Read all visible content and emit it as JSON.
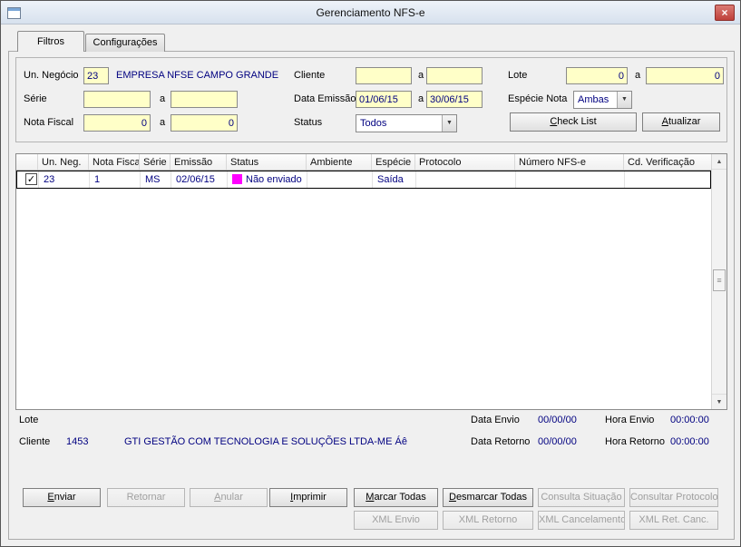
{
  "window": {
    "title": "Gerenciamento NFS-e"
  },
  "icons": {
    "close": "×",
    "dropdown_arrow": "▼",
    "checkmark": "✓",
    "scroll_up": "▲",
    "scroll_down": "▼",
    "grip": "≡"
  },
  "tabs": [
    {
      "label": "Filtros",
      "active": true
    },
    {
      "label": "Configurações",
      "active": false
    }
  ],
  "filters": {
    "sep": "a",
    "un_negocio": {
      "label": "Un. Negócio",
      "value": "23",
      "description": "EMPRESA NFSE CAMPO GRANDE"
    },
    "cliente": {
      "label": "Cliente",
      "from": "",
      "to": ""
    },
    "lote": {
      "label": "Lote",
      "from": "0",
      "to": "0"
    },
    "serie": {
      "label": "Série",
      "from": "",
      "to": ""
    },
    "data_emissao": {
      "label": "Data Emissão",
      "from": "01/06/15",
      "to": "30/06/15"
    },
    "especie_nota": {
      "label": "Espécie Nota",
      "value": "Ambas"
    },
    "nota_fiscal": {
      "label": "Nota Fiscal",
      "from": "0",
      "to": "0"
    },
    "status": {
      "label": "Status",
      "value": "Todos"
    },
    "check_list_button": "Check List",
    "atualizar_button": "Atualizar"
  },
  "grid": {
    "columns": [
      "",
      "Un. Neg.",
      "Nota Fiscal",
      "Série",
      "Emissão",
      "Status",
      "Ambiente",
      "Espécie",
      "Protocolo",
      "Número NFS-e",
      "Cd. Verificação"
    ],
    "rows": [
      {
        "checked": true,
        "un_neg": "23",
        "nota_fiscal": "1",
        "serie": "MS",
        "emissao": "02/06/15",
        "status": "Não enviado",
        "status_color": "#FF00FF",
        "ambiente": "",
        "especie": "Saída",
        "protocolo": "",
        "numero_nfse": "",
        "cd_verificacao": ""
      }
    ]
  },
  "details": {
    "lote_label": "Lote",
    "lote_value": "",
    "cliente_label": "Cliente",
    "cliente_code": "1453",
    "cliente_name": "GTI GESTÃO COM TECNOLOGIA E SOLUÇÕES LTDA-ME Áê",
    "data_envio_label": "Data Envio",
    "data_envio_value": "00/00/00",
    "hora_envio_label": "Hora Envio",
    "hora_envio_value": "00:00:00",
    "data_retorno_label": "Data Retorno",
    "data_retorno_value": "00/00/00",
    "hora_retorno_label": "Hora Retorno",
    "hora_retorno_value": "00:00:00"
  },
  "actions": {
    "row1": [
      {
        "label": "Enviar",
        "enabled": true
      },
      {
        "label": "Retornar",
        "enabled": false
      },
      {
        "label": "Anular",
        "enabled": false
      },
      {
        "label": "Imprimir",
        "enabled": true
      },
      {
        "label": "Marcar Todas",
        "enabled": true
      },
      {
        "label": "Desmarcar Todas",
        "enabled": true
      },
      {
        "label": "Consulta Situação",
        "enabled": false
      },
      {
        "label": "Consultar Protocolo",
        "enabled": false
      }
    ],
    "row2": [
      {
        "label": "XML Envio",
        "enabled": false
      },
      {
        "label": "XML Retorno",
        "enabled": false
      },
      {
        "label": "XML Cancelamento",
        "enabled": false
      },
      {
        "label": "XML Ret. Canc.",
        "enabled": false
      }
    ]
  },
  "colors": {
    "field_bg": "#FFFFC8",
    "value_text": "#000080",
    "status_nao_enviado": "#FF00FF",
    "close_button": "#BF403A"
  }
}
